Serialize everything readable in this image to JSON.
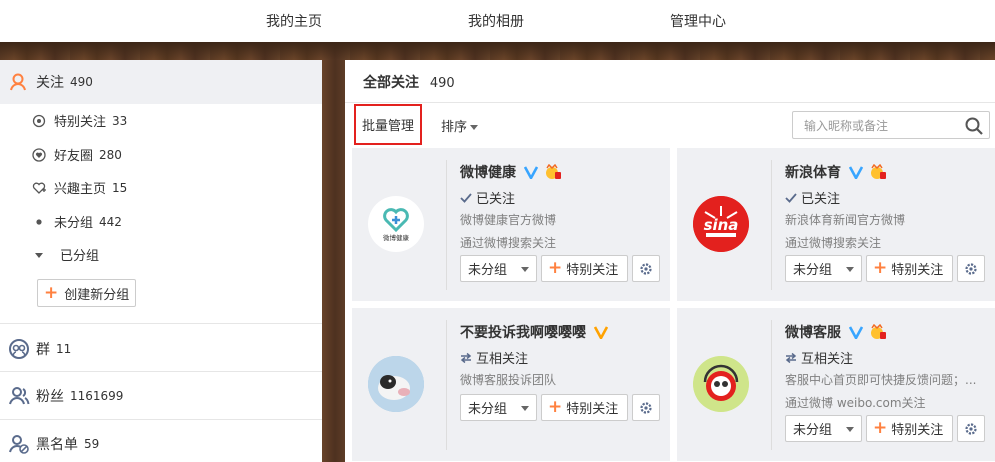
{
  "topnav": [
    "我的主页",
    "我的相册",
    "管理中心"
  ],
  "sidebar": {
    "follow": {
      "label": "关注",
      "count": "490"
    },
    "subs": [
      {
        "label": "特别关注",
        "count": "33",
        "icon": "eye-icon"
      },
      {
        "label": "好友圈",
        "count": "280",
        "icon": "heart-circle-icon"
      },
      {
        "label": "兴趣主页",
        "count": "15",
        "icon": "heart-plus-icon"
      },
      {
        "label": "未分组",
        "count": "442",
        "icon": "dot-icon"
      },
      {
        "label": "已分组",
        "count": "",
        "icon": "caret-down-icon"
      }
    ],
    "new_group": "创建新分组",
    "group": {
      "label": "群",
      "count": "11"
    },
    "fans": {
      "label": "粉丝",
      "count": "1161699"
    },
    "blacklist": {
      "label": "黑名单",
      "count": "59"
    }
  },
  "main": {
    "title": "全部关注",
    "count": "490",
    "batch": "批量管理",
    "sort": "排序",
    "search_placeholder": "输入昵称或备注"
  },
  "cards": [
    {
      "name": "微博健康",
      "verified_color": "#38a5ff",
      "status": "已关注",
      "status_icon": "check-icon",
      "desc": "微博健康官方微博",
      "source": "通过微博搜索关注",
      "group": "未分组",
      "special": "特别关注",
      "avatar_text": "微博健康"
    },
    {
      "name": "新浪体育",
      "verified_color": "#38a5ff",
      "status": "已关注",
      "status_icon": "check-icon",
      "desc": "新浪体育新闻官方微博",
      "source": "通过微博搜索关注",
      "group": "未分组",
      "special": "特别关注",
      "avatar_text": "sina"
    },
    {
      "name": "不要投诉我啊嘤嘤嘤",
      "verified_color": "#ffa200",
      "status": "互相关注",
      "status_icon": "mutual-icon",
      "desc": "微博客服投诉团队",
      "source": "",
      "group": "未分组",
      "special": "特别关注",
      "avatar_text": ""
    },
    {
      "name": "微博客服",
      "verified_color": "#38a5ff",
      "status": "互相关注",
      "status_icon": "mutual-icon",
      "desc": "客服中心首页即可快捷反馈问题；...",
      "source": "通过微博 weibo.com关注",
      "group": "未分组",
      "special": "特别关注",
      "avatar_text": ""
    }
  ]
}
